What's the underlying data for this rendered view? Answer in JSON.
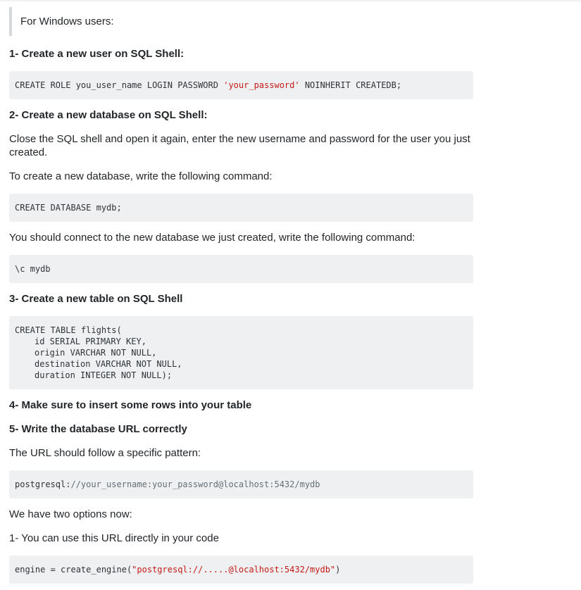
{
  "intro": "For Windows users:",
  "step1": {
    "heading": "1- Create a new user on SQL Shell:",
    "code_pre": "CREATE ROLE you_user_name LOGIN PASSWORD ",
    "code_str": "'your_password'",
    "code_post": " NOINHERIT CREATEDB;"
  },
  "step2": {
    "heading": "2- Create a new database on SQL Shell:",
    "para1": "Close the SQL shell and open it again, enter the new username and password for the user you just created.",
    "para2": "To create a new database, write the following command:",
    "code1": "CREATE DATABASE mydb;",
    "para3": "You should connect to the new database we just created, write the following command:",
    "code2": "\\c mydb"
  },
  "step3": {
    "heading": "3- Create a new table on SQL Shell",
    "code_lines": [
      "CREATE TABLE flights(",
      "id SERIAL PRIMARY KEY,",
      "origin VARCHAR NOT NULL,",
      "destination VARCHAR NOT NULL,",
      "duration INTEGER NOT NULL);"
    ]
  },
  "step4": {
    "heading": "4- Make sure to insert some rows into your table"
  },
  "step5": {
    "heading": "5- Write the database URL correctly",
    "para1": "The URL should follow a specific pattern:",
    "url_scheme": "postgresql:",
    "url_rest": "//your_username:your_password@localhost:5432/mydb",
    "para2": "We have two options now:",
    "para3": "1- You can use this URL directly in your code",
    "engine_pre": "engine = create_engine(",
    "engine_str": "\"postgresql://.....@localhost:5432/mydb\"",
    "engine_post": ")"
  }
}
